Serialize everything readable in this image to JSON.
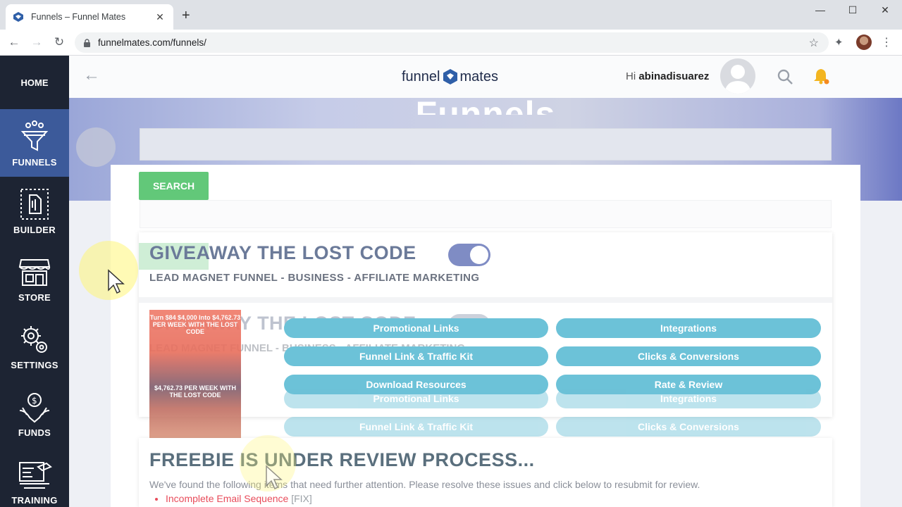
{
  "browser": {
    "tab_title": "Funnels – Funnel Mates",
    "url": "funnelmates.com/funnels/",
    "new_tab": "+",
    "minimize": "—",
    "maximize": "☐",
    "close": "✕"
  },
  "sidebar": {
    "home": "HOME",
    "items": [
      {
        "label": "FUNNELS",
        "icon": "funnel-icon",
        "active": true
      },
      {
        "label": "BUILDER",
        "icon": "builder-icon"
      },
      {
        "label": "STORE",
        "icon": "store-icon"
      },
      {
        "label": "SETTINGS",
        "icon": "gear-icon"
      },
      {
        "label": "FUNDS",
        "icon": "funds-icon"
      },
      {
        "label": "TRAINING",
        "icon": "training-icon"
      }
    ]
  },
  "header": {
    "logo_left": "funnel",
    "logo_right": "mates",
    "greeting": "Hi",
    "username": "abinadisuarez"
  },
  "hero": {
    "title": "Funnels"
  },
  "search": {
    "button_label": "SEARCH"
  },
  "funnel": {
    "title": "GIVEAWAY THE LOST CODE",
    "subtitle": "LEAD MAGNET FUNNEL - BUSINESS - AFFILIATE MARKETING",
    "enabled": true,
    "thumb_line1": "Turn $84 $4,000 Into $4,762.73 PER WEEK WITH THE LOST CODE",
    "thumb_line2": "$4,762.73 PER WEEK WITH THE LOST CODE",
    "actions": [
      "Promotional Links",
      "Integrations",
      "Funnel Link & Traffic Kit",
      "Clicks & Conversions",
      "Download Resources",
      "Rate & Review"
    ],
    "ghost_title": "GIVEAWAY THE LOST CODE",
    "ghost_subtitle": "LEAD MAGNET FUNNEL - BUSINESS - AFFILIATE MARKETING"
  },
  "review": {
    "title": "FREEBIE IS UNDER REVIEW PROCESS...",
    "text": "We've found the following items that need further attention. Please resolve these issues and click below to resubmit for review.",
    "issue": "Incomplete Email Sequence",
    "fix": "[FIX]"
  },
  "colors": {
    "sidebar": "#1d2433",
    "active": "#3c5a9a",
    "search_green": "#62c879",
    "pill": "#6cc2d8",
    "error": "#e84c5b"
  }
}
